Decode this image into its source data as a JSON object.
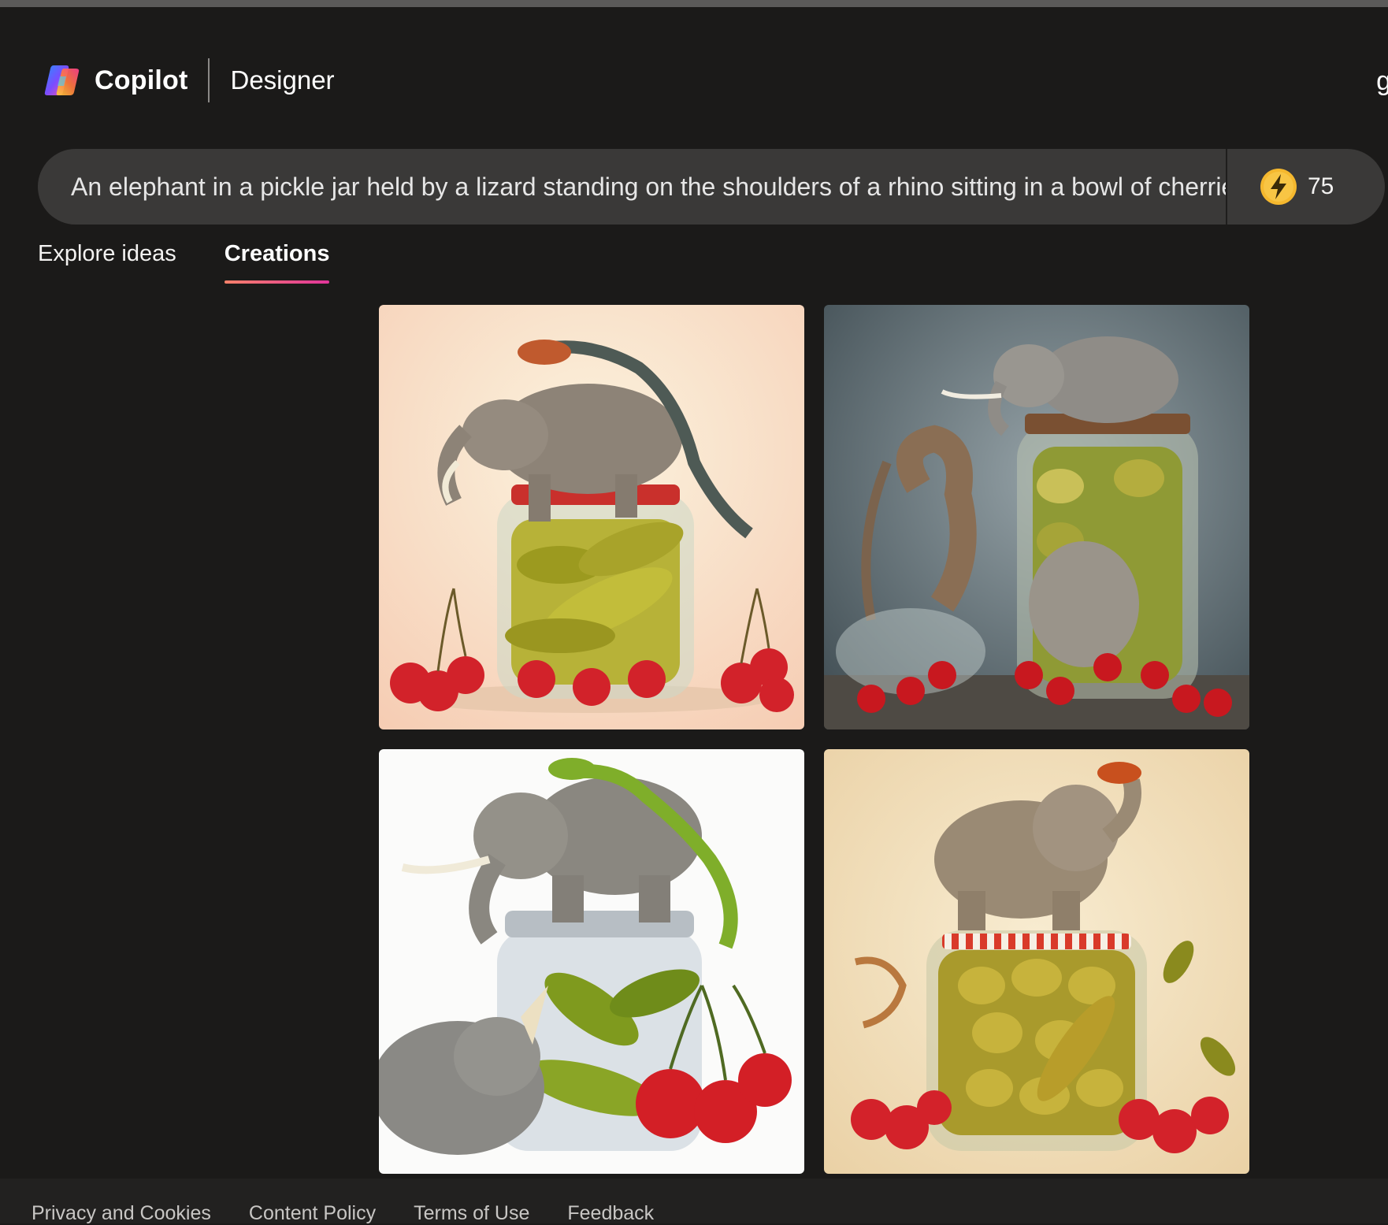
{
  "header": {
    "brand": "Copilot",
    "product": "Designer",
    "edge_glyph": "g"
  },
  "prompt": {
    "value": "An elephant in a pickle jar held by a lizard standing on the shoulders of a rhino sitting in a bowl of cherries"
  },
  "boosts": {
    "count": "75",
    "icon": "lightning-coin-icon"
  },
  "tabs": [
    {
      "label": "Explore ideas",
      "active": false
    },
    {
      "label": "Creations",
      "active": true
    }
  ],
  "colors": {
    "background": "#1b1a19",
    "prompt_bar": "#3a3938",
    "tab_underline_start": "#f7816a",
    "tab_underline_end": "#e1349a",
    "boost_coin": "#f5b82e"
  },
  "footer": {
    "links": [
      "Privacy and Cookies",
      "Content Policy",
      "Terms of Use",
      "Feedback"
    ]
  }
}
